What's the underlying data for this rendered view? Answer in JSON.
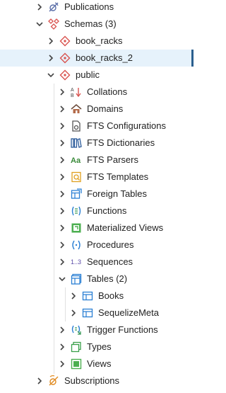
{
  "tree": {
    "publications": "Publications",
    "schemas": "Schemas (3)",
    "book_racks": "book_racks",
    "book_racks_2": "book_racks_2",
    "public": "public",
    "collations": "Collations",
    "domains": "Domains",
    "fts_configurations": "FTS Configurations",
    "fts_dictionaries": "FTS Dictionaries",
    "fts_parsers": "FTS Parsers",
    "fts_templates": "FTS Templates",
    "foreign_tables": "Foreign Tables",
    "functions": "Functions",
    "materialized_views": "Materialized Views",
    "procedures": "Procedures",
    "sequences": "Sequences",
    "tables": "Tables (2)",
    "books": "Books",
    "sequelizemeta": "SequelizeMeta",
    "trigger_functions": "Trigger Functions",
    "types": "Types",
    "views": "Views",
    "subscriptions": "Subscriptions"
  },
  "icon_text": {
    "fts_parsers": "Aa",
    "sequences": "1..3"
  },
  "colors": {
    "selected_bg": "#e6f2fb",
    "selected_bar": "#2b5f8f",
    "schema_red": "#d9534f",
    "table_blue": "#2a7fd4",
    "green": "#4caf50"
  }
}
